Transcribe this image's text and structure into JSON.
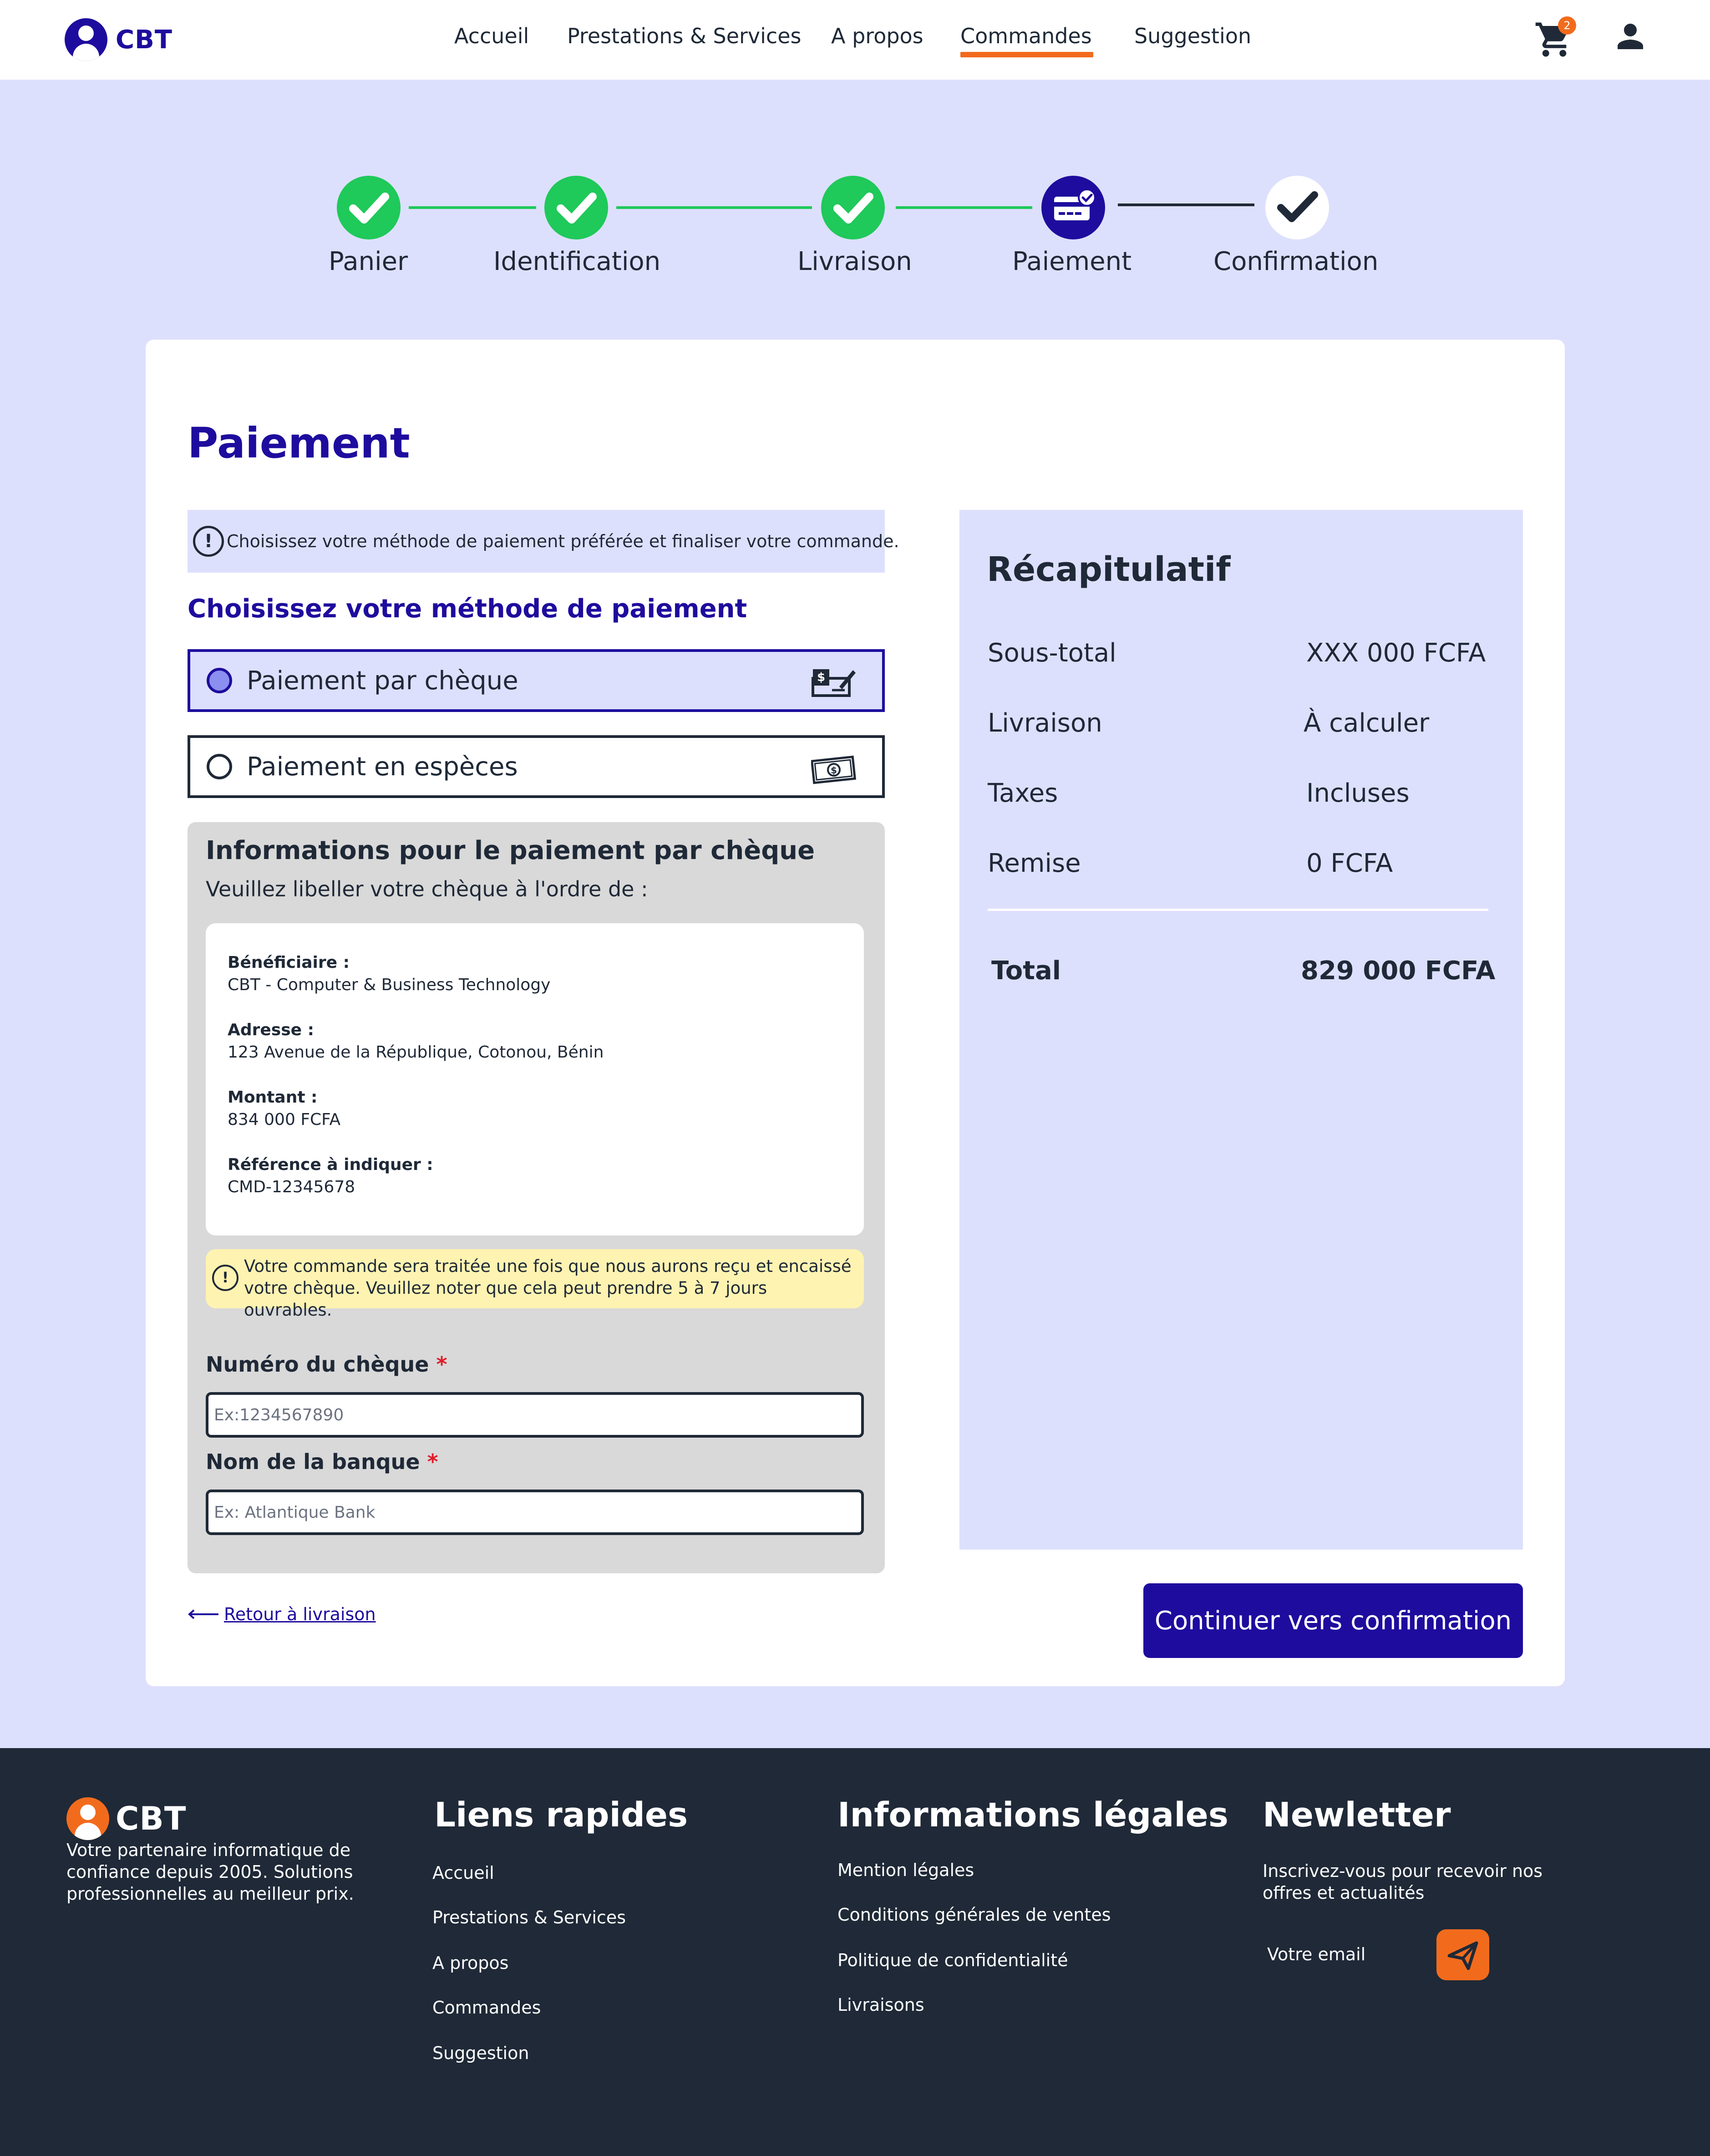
{
  "brand": {
    "name": "CBT"
  },
  "nav": {
    "items": [
      "Accueil",
      "Prestations & Services",
      "A propos",
      "Commandes",
      "Suggestion"
    ],
    "active": "Commandes"
  },
  "cart": {
    "count": "2"
  },
  "stepper": {
    "steps": [
      {
        "label": "Panier",
        "state": "done"
      },
      {
        "label": "Identification",
        "state": "done"
      },
      {
        "label": "Livraison",
        "state": "done"
      },
      {
        "label": "Paiement",
        "state": "current"
      },
      {
        "label": "Confirmation",
        "state": "pending"
      }
    ]
  },
  "payment": {
    "title": "Paiement",
    "info": "Choisissez votre méthode de paiement préférée et finaliser votre commande.",
    "subtitle": "Choisissez votre méthode de paiement",
    "methods": [
      {
        "label": "Paiement par chèque",
        "icon": "cheque-icon",
        "selected": true
      },
      {
        "label": "Paiement en espèces",
        "icon": "cash-icon",
        "selected": false
      }
    ],
    "cheque": {
      "title": "Informations pour le paiement par chèque",
      "subtitle": "Veuillez libeller votre chèque à l'ordre de :",
      "beneficiary_label": "Bénéficiaire :",
      "beneficiary": "CBT - Computer & Business Technology",
      "address_label": "Adresse :",
      "address": "123 Avenue de la République, Cotonou, Bénin",
      "amount_label": "Montant :",
      "amount": "834 000 FCFA",
      "reference_label": "Référence à indiquer :",
      "reference": "CMD-12345678",
      "warning": "Votre commande sera traitée une fois que nous aurons reçu et encaissé votre chèque. Veuillez noter que cela peut prendre 5 à 7 jours ouvrables.",
      "cheque_number_label": "Numéro du chèque",
      "cheque_number_placeholder": "Ex:1234567890",
      "bank_label": "Nom de la banque",
      "bank_placeholder": "Ex: Atlantique Bank",
      "required_mark": "*"
    },
    "back_link": "Retour à livraison",
    "continue_button": "Continuer vers confirmation"
  },
  "summary": {
    "title": "Récapitulatif",
    "rows": [
      {
        "label": "Sous-total",
        "value": "XXX 000 FCFA"
      },
      {
        "label": "Livraison",
        "value": "À calculer"
      },
      {
        "label": "Taxes",
        "value": "Incluses"
      },
      {
        "label": "Remise",
        "value": "0 FCFA"
      }
    ],
    "total_label": "Total",
    "total_value": "829 000 FCFA"
  },
  "footer": {
    "brand": "CBT",
    "description": "Votre partenaire informatique de confiance depuis 2005. Solutions professionnelles au meilleur prix.",
    "quick_links_title": "Liens rapides",
    "quick_links": [
      "Accueil",
      "Prestations & Services",
      "A propos",
      "Commandes",
      "Suggestion"
    ],
    "legal_title": "Informations légales",
    "legal_links": [
      "Mention légales",
      "Conditions générales de ventes",
      "Politique de confidentialité",
      "Livraisons"
    ],
    "newsletter_title": "Newletter",
    "newsletter_text": "Inscrivez-vous pour recevoir nos offres et actualités",
    "newsletter_placeholder": "Votre email"
  },
  "colors": {
    "primary": "#1e0c9e",
    "accent": "#f26b1d",
    "success": "#1fc95a",
    "light_bg": "#dde0fc",
    "dark": "#1f2937"
  }
}
